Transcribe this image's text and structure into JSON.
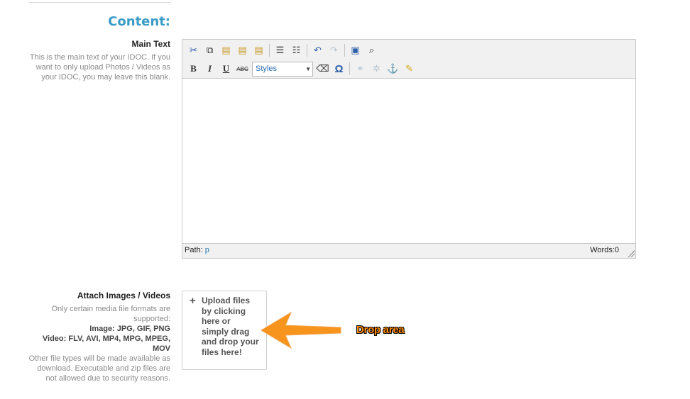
{
  "section": {
    "title": "Content:"
  },
  "main_text": {
    "label": "Main Text",
    "help": "This is the main text of your IDOC. If you want to only upload Photos / Videos as your IDOC, you may leave this blank."
  },
  "editor": {
    "toolbar_row1": [
      {
        "name": "cut-icon",
        "glyph": "✂"
      },
      {
        "name": "copy-icon",
        "glyph": "⧉"
      },
      {
        "name": "paste-icon",
        "glyph": "📋"
      },
      {
        "name": "paste-text-icon",
        "glyph": "📋"
      },
      {
        "name": "paste-word-icon",
        "glyph": "📋"
      },
      {
        "name": "bullet-list-icon",
        "glyph": "☰"
      },
      {
        "name": "numbered-list-icon",
        "glyph": "☰"
      },
      {
        "name": "undo-icon",
        "glyph": "↶"
      },
      {
        "name": "redo-icon",
        "glyph": "↷"
      },
      {
        "name": "source-code-icon",
        "glyph": "▣"
      },
      {
        "name": "preview-icon",
        "glyph": "🔍"
      }
    ],
    "bold": "B",
    "italic": "I",
    "underline": "U",
    "strike": "ABC",
    "styles_value": "Styles",
    "path_label": "Path:",
    "path_value": "p",
    "words_label": "Words:0"
  },
  "attach": {
    "label": "Attach Images / Videos",
    "help_intro": "Only certain media file formats are supported:",
    "image_formats": "Image: JPG, GIF, PNG",
    "video_formats": "Video: FLV, AVI, MP4, MPG, MPEG, MOV",
    "help_outro": "Other file types will be made available as download. Executable and zip files are not allowed due to security reasons.",
    "upload_text": "Upload files by clicking here or simply drag and drop your files here!"
  },
  "annotation": {
    "drop_label": "Drop area",
    "arrow_color": "#f7941d"
  },
  "colors": {
    "accent": "#3a9cc6",
    "link": "#2a7ab0"
  }
}
